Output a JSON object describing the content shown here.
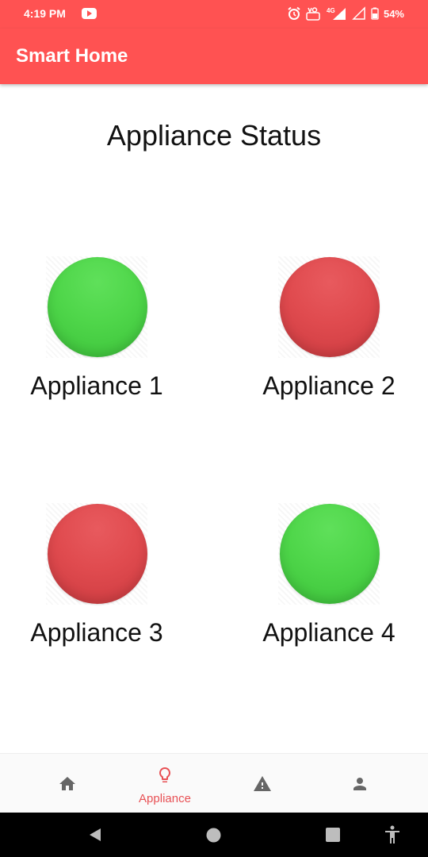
{
  "status_bar": {
    "time": "4:19 PM",
    "battery": "54%",
    "icons": [
      "youtube-icon",
      "alarm-icon",
      "volte-icon",
      "signal-4g-icon",
      "signal-icon",
      "battery-icon"
    ]
  },
  "app_bar": {
    "title": "Smart Home"
  },
  "main": {
    "title": "Appliance Status",
    "appliances": [
      {
        "label": "Appliance 1",
        "status": "on",
        "color": "#4fd64a"
      },
      {
        "label": "Appliance 2",
        "status": "off",
        "color": "#e04b4f"
      },
      {
        "label": "Appliance 3",
        "status": "off",
        "color": "#e04b4f"
      },
      {
        "label": "Appliance 4",
        "status": "on",
        "color": "#4fd64a"
      }
    ]
  },
  "bottom_nav": {
    "items": [
      {
        "icon": "home-icon",
        "label": ""
      },
      {
        "icon": "lightbulb-icon",
        "label": "Appliance",
        "active": true
      },
      {
        "icon": "warning-icon",
        "label": ""
      },
      {
        "icon": "person-icon",
        "label": ""
      }
    ],
    "active_color": "#e85155",
    "inactive_color": "#666666"
  },
  "system_nav": {
    "icons": [
      "back-icon",
      "home-circle-icon",
      "recents-icon",
      "accessibility-icon"
    ]
  },
  "colors": {
    "accent": "#ff5252",
    "on": "#4fd64a",
    "off": "#e04b4f"
  }
}
